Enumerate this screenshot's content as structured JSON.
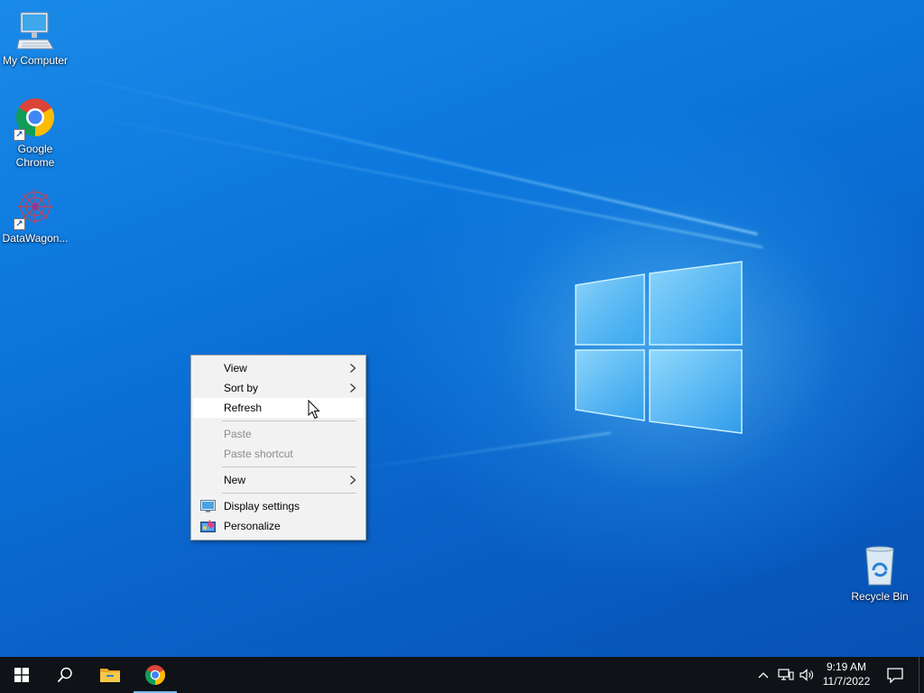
{
  "desktop": {
    "icons": [
      {
        "label": "My Computer",
        "icon": "computer-icon"
      },
      {
        "label": "Google Chrome",
        "icon": "chrome-icon"
      },
      {
        "label": "DataWagon...",
        "icon": "datawagon-icon"
      },
      {
        "label": "Recycle Bin",
        "icon": "recycle-bin-icon"
      }
    ]
  },
  "context_menu": {
    "items": [
      {
        "label": "View",
        "has_submenu": true,
        "disabled": false
      },
      {
        "label": "Sort by",
        "has_submenu": true,
        "disabled": false
      },
      {
        "label": "Refresh",
        "has_submenu": false,
        "disabled": false,
        "hovered": true
      },
      {
        "label": "Paste",
        "has_submenu": false,
        "disabled": true
      },
      {
        "label": "Paste shortcut",
        "has_submenu": false,
        "disabled": true
      },
      {
        "label": "New",
        "has_submenu": true,
        "disabled": false
      },
      {
        "label": "Display settings",
        "icon": "display-settings-icon",
        "disabled": false
      },
      {
        "label": "Personalize",
        "icon": "personalize-icon",
        "disabled": false
      }
    ]
  },
  "taskbar": {
    "buttons": [
      {
        "name": "start",
        "icon": "windows-logo-icon"
      },
      {
        "name": "search",
        "icon": "search-icon"
      },
      {
        "name": "file-explorer",
        "icon": "folder-icon"
      },
      {
        "name": "chrome",
        "icon": "chrome-icon"
      }
    ],
    "tray": {
      "icons": [
        "chevron-up-icon",
        "network-icon",
        "volume-icon"
      ],
      "time": "9:19 AM",
      "date": "11/7/2022",
      "notification_icon": "action-center-icon"
    }
  },
  "colors": {
    "desktop_blue": "#0a6fd6",
    "taskbar": "#0f1216",
    "menu_bg": "#f2f2f2",
    "menu_hover": "#ffffff",
    "menu_disabled_text": "#8c8c8c"
  }
}
